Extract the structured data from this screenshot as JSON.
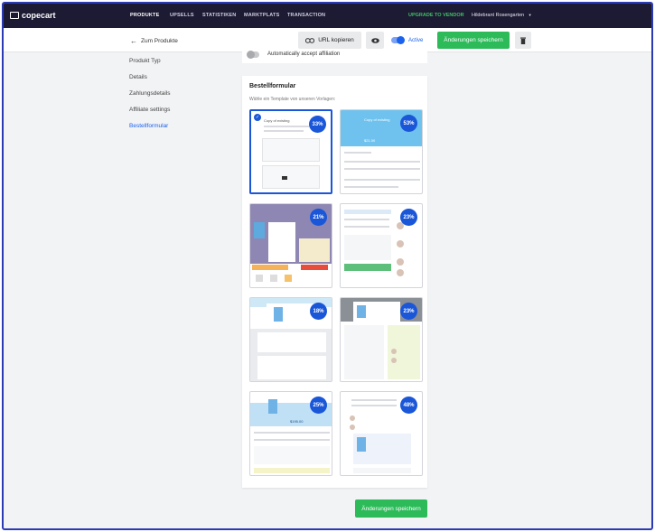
{
  "brand": {
    "name": "copecart"
  },
  "nav": {
    "items": [
      {
        "label": "PRODUKTE",
        "active": true
      },
      {
        "label": "UPSELLS",
        "active": false
      },
      {
        "label": "STATISTIKEN",
        "active": false
      },
      {
        "label": "MARKTPLATS",
        "active": false
      },
      {
        "label": "TRANSACTION",
        "active": false
      }
    ],
    "upgrade_label": "UPGRADE TO VENDOR",
    "user_name": "Hildebrant Rosengarten"
  },
  "toolbar": {
    "back_label": "Zum Produkte",
    "url_copy_label": "URL kopieren",
    "active_label": "Active",
    "active_on": true,
    "save_label": "Änderungen speichern"
  },
  "sidebar": {
    "items": [
      {
        "label": "Produkt Typ",
        "current": false
      },
      {
        "label": "Details",
        "current": false
      },
      {
        "label": "Zahlungsdetails",
        "current": false
      },
      {
        "label": "Affiliate settings",
        "current": false
      },
      {
        "label": "Bestellformular",
        "current": true
      }
    ]
  },
  "affiliation": {
    "label": "Automatically accept affiliation",
    "on": false
  },
  "order_form": {
    "title": "Bestellformular",
    "subtitle": "Wähle ein Template von unseren Vorlagen:",
    "templates": [
      {
        "percent": "33%",
        "selected": true,
        "heading": "Copy of existing",
        "style": "plain"
      },
      {
        "percent": "53%",
        "selected": false,
        "heading": "Copy of existing",
        "price": "$21.00",
        "style": "blue-header"
      },
      {
        "percent": "21%",
        "selected": false,
        "style": "purple"
      },
      {
        "percent": "23%",
        "selected": false,
        "style": "green-button"
      },
      {
        "percent": "18%",
        "selected": false,
        "style": "blue-top"
      },
      {
        "percent": "23%",
        "selected": false,
        "style": "gray-top"
      },
      {
        "percent": "25%",
        "selected": false,
        "price": "$195.00",
        "style": "blue-band"
      },
      {
        "percent": "48%",
        "selected": false,
        "style": "reviews"
      }
    ]
  },
  "footer": {
    "save_label": "Änderungen speichern"
  },
  "colors": {
    "accent": "#1a56d8",
    "success": "#2dbb5a",
    "nav_bg": "#1d1a33"
  }
}
